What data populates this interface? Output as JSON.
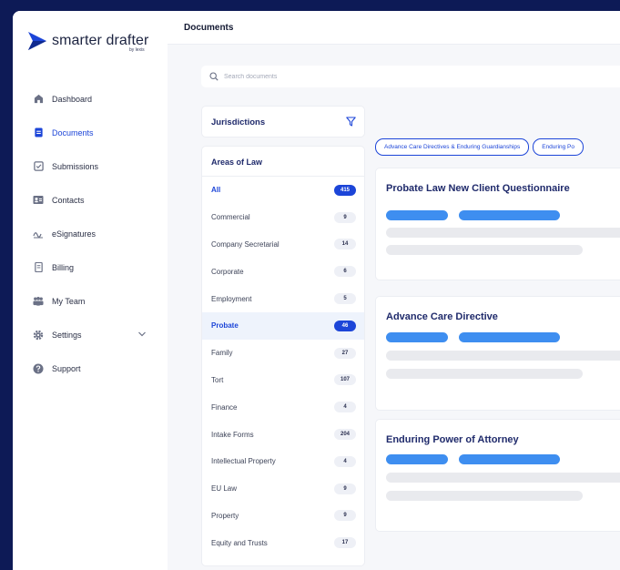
{
  "brand": {
    "name": "smarter drafter",
    "sub": "by lexis"
  },
  "header": {
    "title": "Documents"
  },
  "search": {
    "placeholder": "Search documents"
  },
  "sidebar": {
    "items": [
      {
        "label": "Dashboard",
        "icon": "home-icon"
      },
      {
        "label": "Documents",
        "icon": "document-icon",
        "active": true
      },
      {
        "label": "Submissions",
        "icon": "submission-icon"
      },
      {
        "label": "Contacts",
        "icon": "contact-card-icon"
      },
      {
        "label": "eSignatures",
        "icon": "signature-icon"
      },
      {
        "label": "Billing",
        "icon": "billing-icon"
      },
      {
        "label": "My Team",
        "icon": "team-icon"
      },
      {
        "label": "Settings",
        "icon": "gear-icon"
      },
      {
        "label": "Support",
        "icon": "help-icon"
      }
    ]
  },
  "filters": {
    "jurisdictions_label": "Jurisdictions",
    "areas_label": "Areas of Law",
    "areas": [
      {
        "label": "All",
        "count": "415"
      },
      {
        "label": "Commercial",
        "count": "9"
      },
      {
        "label": "Company Secretarial",
        "count": "14"
      },
      {
        "label": "Corporate",
        "count": "6"
      },
      {
        "label": "Employment",
        "count": "5"
      },
      {
        "label": "Probate",
        "count": "46"
      },
      {
        "label": "Family",
        "count": "27"
      },
      {
        "label": "Tort",
        "count": "107"
      },
      {
        "label": "Finance",
        "count": "4"
      },
      {
        "label": "Intake Forms",
        "count": "204"
      },
      {
        "label": "Intellectual Property",
        "count": "4"
      },
      {
        "label": "EU Law",
        "count": "9"
      },
      {
        "label": "Property",
        "count": "9"
      },
      {
        "label": "Equity and Trusts",
        "count": "17"
      }
    ]
  },
  "chips": [
    "Advance Care Directives & Enduring Guardianships",
    "Enduring Po"
  ],
  "cards": [
    {
      "title": "Probate Law New Client Questionnaire"
    },
    {
      "title": "Advance Care Directive"
    },
    {
      "title": "Enduring Power of Attorney"
    }
  ],
  "colors": {
    "accent": "#1c45d8",
    "pill": "#3e8ef0",
    "frame": "#0d1a56"
  }
}
